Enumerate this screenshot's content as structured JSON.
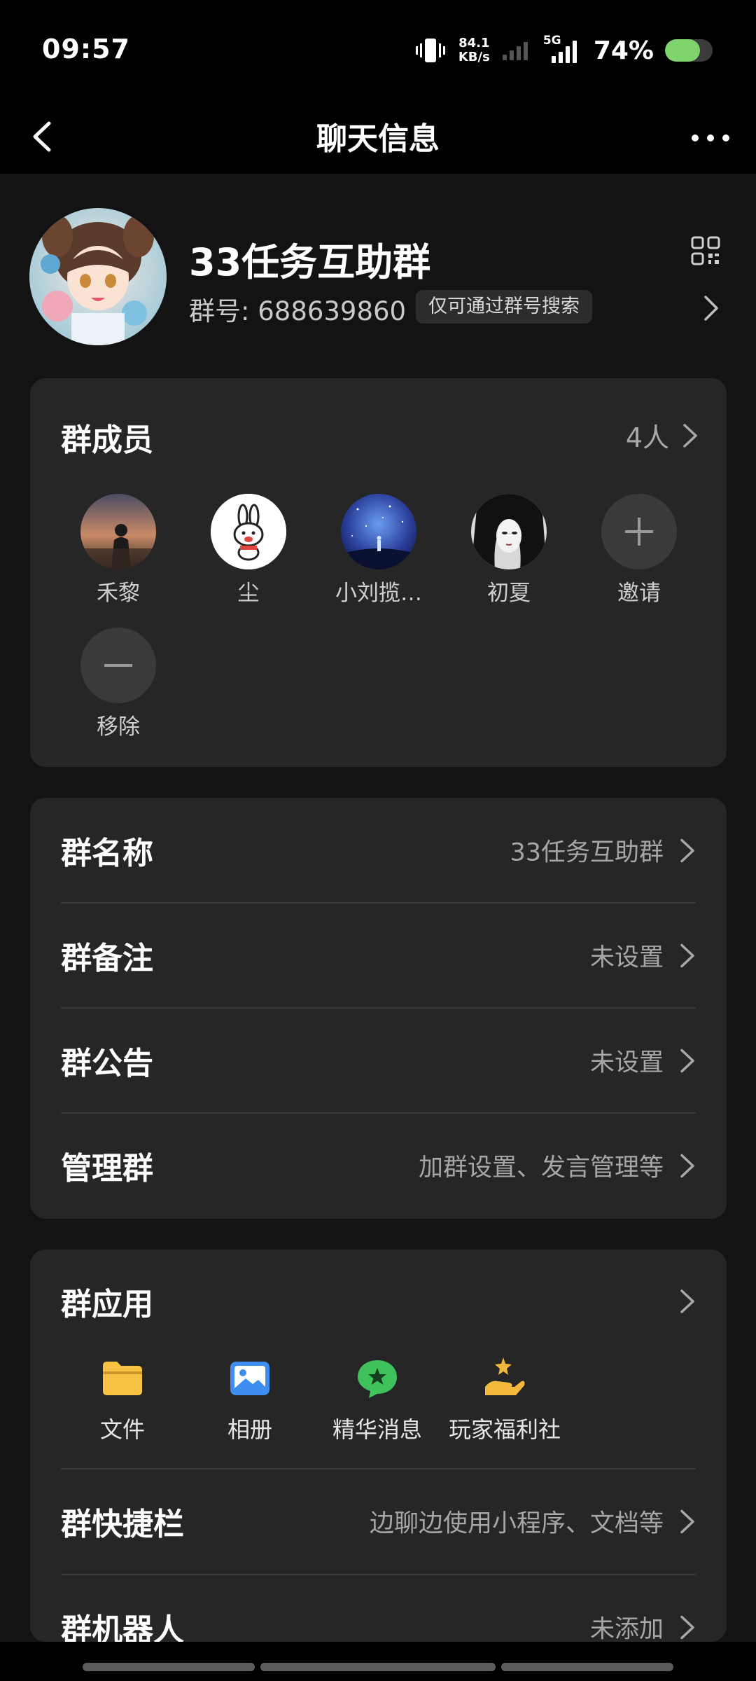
{
  "status_bar": {
    "time": "09:57",
    "net_speed_value": "84.1",
    "net_speed_unit": "KB/s",
    "network_type": "5G",
    "battery_percent": "74%",
    "battery_level": 0.74,
    "battery_color": "#7ed36d"
  },
  "nav": {
    "title": "聊天信息",
    "back_icon": "chevron-left-icon",
    "more_icon": "more-dots-icon"
  },
  "group": {
    "name": "33任务互助群",
    "id_label": "群号:",
    "id_value": "688639860",
    "search_badge": "仅可通过群号搜索",
    "qr_icon": "qr-code-icon"
  },
  "members": {
    "title": "群成员",
    "count": "4人",
    "list": [
      {
        "name": "禾黎"
      },
      {
        "name": "尘"
      },
      {
        "name": "小刘揽…"
      },
      {
        "name": "初夏"
      }
    ],
    "invite_label": "邀请",
    "remove_label": "移除"
  },
  "settings": [
    {
      "label": "群名称",
      "value": "33任务互助群"
    },
    {
      "label": "群备注",
      "value": "未设置"
    },
    {
      "label": "群公告",
      "value": "未设置"
    },
    {
      "label": "管理群",
      "value": "加群设置、发言管理等"
    }
  ],
  "apps": {
    "title": "群应用",
    "items": [
      {
        "label": "文件",
        "icon": "folder-icon",
        "color": "#f5c242"
      },
      {
        "label": "相册",
        "icon": "photo-icon",
        "color": "#3d8ef0"
      },
      {
        "label": "精华消息",
        "icon": "star-bubble-icon",
        "color": "#3fc25b"
      },
      {
        "label": "玩家福利社",
        "icon": "gift-hand-icon",
        "color": "#f4b83a"
      }
    ],
    "shortcut_label": "群快捷栏",
    "shortcut_value": "边聊边使用小程序、文档等",
    "robot_label": "群机器人",
    "robot_value": "未添加"
  }
}
